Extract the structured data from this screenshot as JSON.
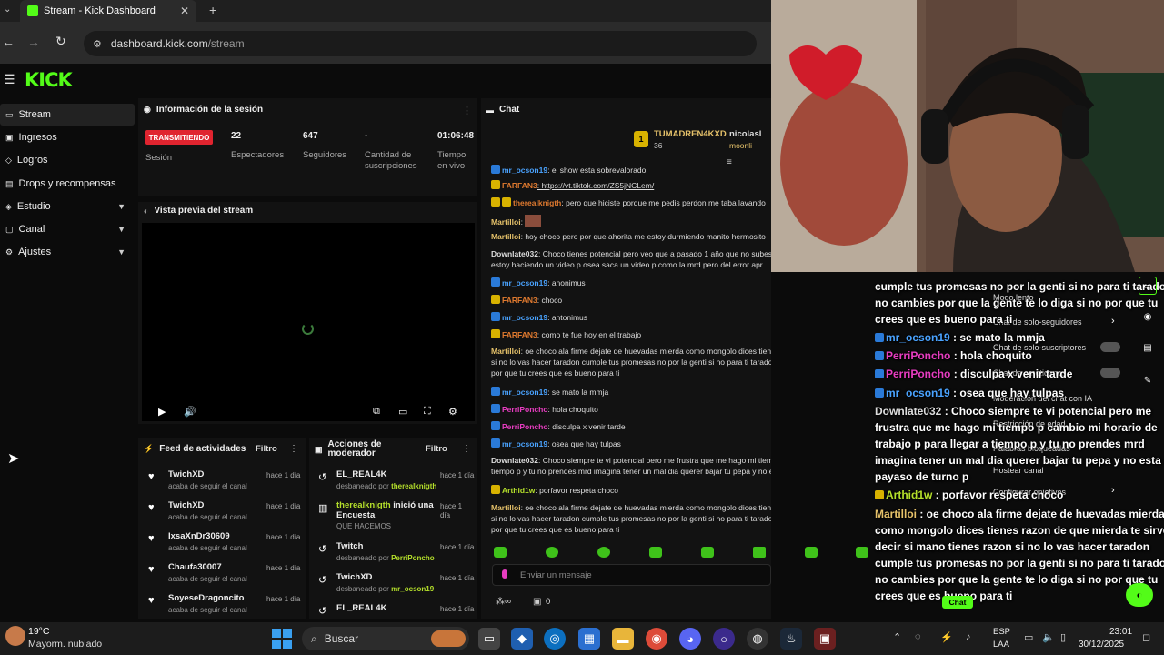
{
  "browser": {
    "tab_title": "Stream - Kick Dashboard",
    "url_domain": "dashboard.kick.com",
    "url_path": "/stream"
  },
  "brand": {
    "logo": "KICK",
    "accent": "#53fc18"
  },
  "sidebar": {
    "items": [
      {
        "label": "Stream"
      },
      {
        "label": "Ingresos"
      },
      {
        "label": "Logros"
      },
      {
        "label": "Drops y recompensas"
      },
      {
        "label": "Estudio"
      },
      {
        "label": "Canal"
      },
      {
        "label": "Ajustes"
      }
    ]
  },
  "session": {
    "title": "Información de la sesión",
    "status": "TRANSMITIENDO",
    "status_label": "Sesión",
    "viewers": "22",
    "viewers_label": "Espectadores",
    "followers": "647",
    "followers_label": "Seguidores",
    "subs": "-",
    "subs_label": "Cantidad de suscripciones",
    "live_time": "01:06:48",
    "live_label": "Tiempo en vivo"
  },
  "preview": {
    "title": "Vista previa del stream"
  },
  "activity": {
    "title": "Feed de actividades",
    "filter": "Filtro",
    "items": [
      {
        "name": "TwichXD",
        "sub": "acaba de seguir el canal",
        "time": "hace 1 día"
      },
      {
        "name": "TwichXD",
        "sub": "acaba de seguir el canal",
        "time": "hace 1 día"
      },
      {
        "name": "IxsaXnDr30609",
        "sub": "acaba de seguir el canal",
        "time": "hace 1 día"
      },
      {
        "name": "Chaufa30007",
        "sub": "acaba de seguir el canal",
        "time": "hace 1 día"
      },
      {
        "name": "SoyeseDragoncito",
        "sub": "acaba de seguir el canal",
        "time": "hace 1 día"
      }
    ]
  },
  "modactions": {
    "title": "Acciones de moderador",
    "filter": "Filtro",
    "items": [
      {
        "name": "EL_REAL4K",
        "sub": "desbaneado por",
        "by": "therealknigth",
        "time": "hace 1 día"
      },
      {
        "name": "therealknigth",
        "extra": "inició una Encuesta",
        "sub": "QUE HACEMOS",
        "time": "hace 1 día"
      },
      {
        "name": "Twitch",
        "sub": "desbaneado por",
        "by": "PerriPoncho",
        "time": "hace 1 día"
      },
      {
        "name": "TwichXD",
        "sub": "desbaneado por",
        "by": "mr_ocson19",
        "time": "hace 1 día"
      },
      {
        "name": "EL_REAL4K",
        "time": "hace 1 día"
      }
    ]
  },
  "chat": {
    "title": "Chat",
    "pinned_user": "TUMADREN4KXD",
    "pinned_count": "36",
    "pinned_user2": "nicolasl",
    "pinned_user2b": "moonli",
    "input_placeholder": "Enviar un mensaje",
    "footer_count": "0",
    "messages": [
      {
        "user": "mr_ocson19",
        "text": ": el show esta sobrevalorado"
      },
      {
        "user": "FARFAN3",
        "text": ": https://vt.tiktok.com/ZS5jNCLem/"
      },
      {
        "user": "therealknigth",
        "text": ": pero que hiciste porque me pedis perdon me taba lavando"
      },
      {
        "user": "Martilloi",
        "text": ":"
      },
      {
        "user": "Martilloi",
        "text": ": hoy choco pero por que ahorita me estoy durmiendo manito hermosito"
      },
      {
        "user": "Downlate032",
        "text": ": Choco tienes potencial pero veo que a pasado 1 año que no subes"
      },
      {
        "user": "",
        "text": "estoy haciendo un video p osea saca un video p como la mrd pero del error apr"
      },
      {
        "user": "mr_ocson19",
        "text": ": anonimus"
      },
      {
        "user": "FARFAN3",
        "text": ": choco"
      },
      {
        "user": "mr_ocson19",
        "text": ": antonimus"
      },
      {
        "user": "FARFAN3",
        "text": ": como te fue hoy en el trabajo"
      },
      {
        "user": "Martilloi",
        "text": ": oe choco ala firme dejate de huevadas mierda como mongolo dices tienes razon de que mierda te sirve decir si mano tienes razon"
      },
      {
        "user": "",
        "text": "si no lo vas hacer taradon cumple tus promesas no por la genti si no para ti taradon no cambies por que la gente te lo diga si no por que tu"
      },
      {
        "user": "",
        "text": "por que tu crees que es bueno para ti"
      },
      {
        "user": "mr_ocson19",
        "text": ": se mato la mmja"
      },
      {
        "user": "PerriPoncho",
        "text": ": hola choquito"
      },
      {
        "user": "PerriPoncho",
        "text": ": disculpa x venir tarde"
      },
      {
        "user": "mr_ocson19",
        "text": ": osea que hay tulpas"
      },
      {
        "user": "Downlate032",
        "text": ": Choco siempre te vi potencial pero me frustra que me hago mi tiempo p cambio mi horario de"
      },
      {
        "user": "",
        "text": "tiempo p y tu no prendes mrd imagina tener un mal dia querer bajar tu pepa y no esta el payaso de turno p"
      },
      {
        "user": "Arthid1w",
        "text": ": porfavor respeta choco"
      },
      {
        "user": "Martilloi",
        "text": ": oe choco ala firme dejate de huevadas mierda como mongolo dices tienes razon de que mierda te sirve decir si mano tienes razon"
      },
      {
        "user": "",
        "text": "si no lo vas hacer taradon cumple tus promesas no por la genti si no para ti taradon no cambies por que la gente te lo diga si no por que tu"
      },
      {
        "user": "",
        "text": "por que tu crees que es bueno para ti"
      }
    ]
  },
  "overlay": {
    "lines": [
      {
        "user": "",
        "text": "cumple tus promesas no por la genti si no para ti taradon"
      },
      {
        "user": "",
        "text": "no cambies por que la gente te lo diga si no por que tu"
      },
      {
        "user": "",
        "text": "crees que es bueno para ti"
      },
      {
        "user": "mr_ocson19",
        "text": " : se mato la mmja"
      },
      {
        "user": "PerriPoncho",
        "text": " : hola choquito"
      },
      {
        "user": "PerriPoncho",
        "text": " : disculpa x venir tarde"
      },
      {
        "user": "mr_ocson19",
        "text": " : osea que hay tulpas"
      },
      {
        "user": "Downlate032",
        "text": " : Choco siempre te vi potencial pero me"
      },
      {
        "user": "",
        "text": "frustra que me hago mi tiempo p cambio mi horario de"
      },
      {
        "user": "",
        "text": "trabajo p para llegar a tiempo p y tu no prendes mrd"
      },
      {
        "user": "",
        "text": "imagina tener un mal dia querer bajar tu pepa y no esta el"
      },
      {
        "user": "",
        "text": "payaso de turno p"
      },
      {
        "user": "Arthid1w",
        "text": " : porfavor respeta choco"
      },
      {
        "user": "Martilloi",
        "text": " : oe choco ala firme dejate de huevadas mierda"
      },
      {
        "user": "",
        "text": "como mongolo dices tienes razon de que mierda te sirve"
      },
      {
        "user": "",
        "text": "decir si mano tienes razon si no lo vas hacer taradon"
      },
      {
        "user": "",
        "text": "cumple tus promesas no por la genti si no para ti taradon"
      },
      {
        "user": "",
        "text": "no cambies por que la gente te lo diga si no por que tu"
      },
      {
        "user": "",
        "text": "crees que es bueno para ti"
      }
    ],
    "ghost_menu": [
      "Modo lento",
      "Chat de solo-seguidores",
      "Chat de solo-suscriptores",
      "Chat de emoticonos",
      "Moderación del chat con IA",
      "Restricción de edad",
      "Palabras bloqueadas",
      "Hostear canal",
      "Configurar objetivos"
    ],
    "chat_button": "Chat"
  },
  "taskbar": {
    "weather_temp": "19°C",
    "weather_desc": "Mayorm. nublado",
    "search": "Buscar",
    "lang": "ESP",
    "lang2": "LAA",
    "time": "23:01",
    "date": "30/12/2025"
  }
}
